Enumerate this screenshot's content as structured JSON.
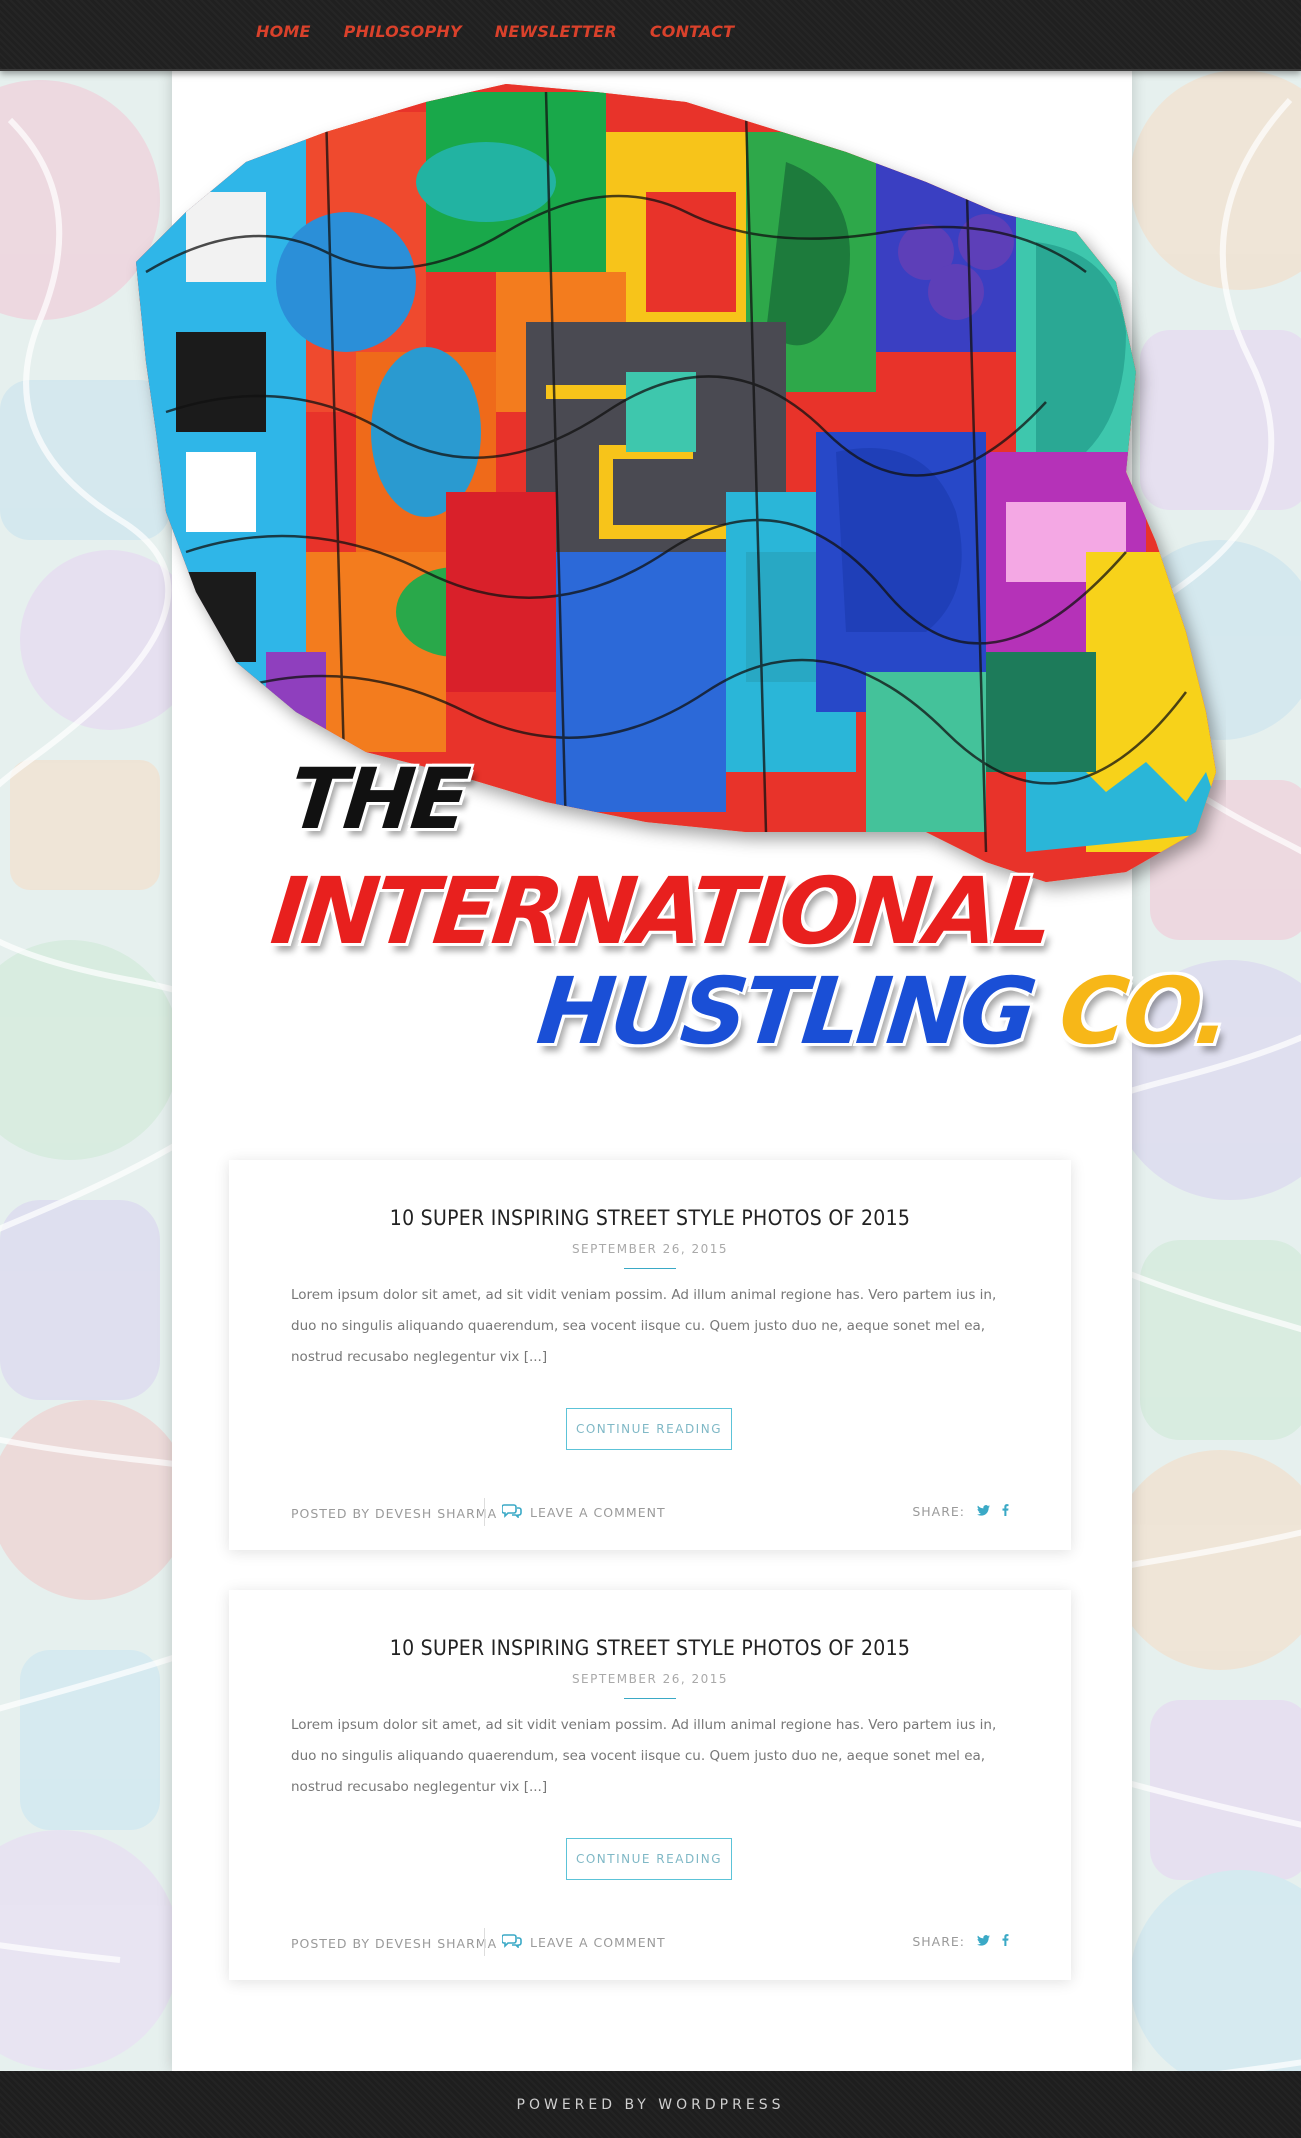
{
  "nav": {
    "items": [
      {
        "label": "HOME"
      },
      {
        "label": "PHILOSOPHY"
      },
      {
        "label": "NEWSLETTER"
      },
      {
        "label": "CONTACT"
      }
    ]
  },
  "brand": {
    "line1": "THE",
    "line2": "INTERNATIONAL",
    "line3": "HUSTLING",
    "line3_accent": "CO."
  },
  "posts": [
    {
      "title": "10 SUPER INSPIRING STREET STYLE PHOTOS OF 2015",
      "date": "SEPTEMBER 26, 2015",
      "excerpt": "Lorem ipsum dolor sit amet, ad sit vidit veniam possim. Ad illum animal regione has. Vero partem ius in, duo no singulis aliquando quaerendum, sea vocent iisque cu. Quem justo duo ne, aeque sonet mel ea, nostrud recusabo neglegentur vix [...]",
      "button": "CONTINUE READING",
      "posted_by": "POSTED BY DEVESH SHARMA",
      "comment_link": "LEAVE A COMMENT",
      "share_label": "SHARE:"
    },
    {
      "title": "10 SUPER INSPIRING STREET STYLE PHOTOS OF 2015",
      "date": "SEPTEMBER 26, 2015",
      "excerpt": "Lorem ipsum dolor sit amet, ad sit vidit veniam possim. Ad illum animal regione has. Vero partem ius in, duo no singulis aliquando quaerendum, sea vocent iisque cu. Quem justo duo ne, aeque sonet mel ea, nostrud recusabo neglegentur vix [...]",
      "button": "CONTINUE READING",
      "posted_by": "POSTED BY DEVESH SHARMA",
      "comment_link": "LEAVE A COMMENT",
      "share_label": "SHARE:"
    }
  ],
  "footer": {
    "text": "POWERED BY WORDPRESS"
  },
  "colors": {
    "nav_link": "#d9412b",
    "accent": "#3aa9c6",
    "brand_red": "#e8201e",
    "brand_blue": "#1a4fd6",
    "brand_yellow": "#f7b718",
    "bar_dark": "#202020"
  },
  "icons": [
    "comment-bubbles-icon",
    "twitter-icon",
    "facebook-icon"
  ]
}
